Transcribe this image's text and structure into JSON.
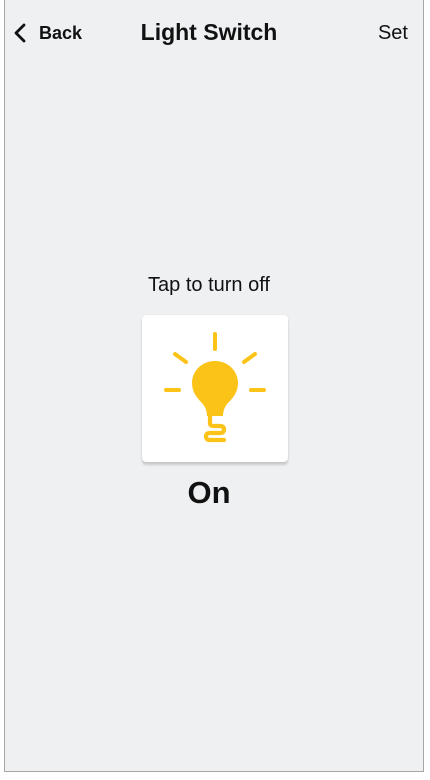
{
  "header": {
    "back_label": "Back",
    "title": "Light Switch",
    "set_label": "Set",
    "back_icon": "chevron-left-icon"
  },
  "main": {
    "hint": "Tap to turn off",
    "state": "On",
    "switch_icon": "lightbulb-on-icon",
    "bulb_color": "#fbc317"
  },
  "colors": {
    "background": "#eff0f2",
    "card": "#ffffff",
    "text": "#111111",
    "accent": "#fbc317"
  }
}
